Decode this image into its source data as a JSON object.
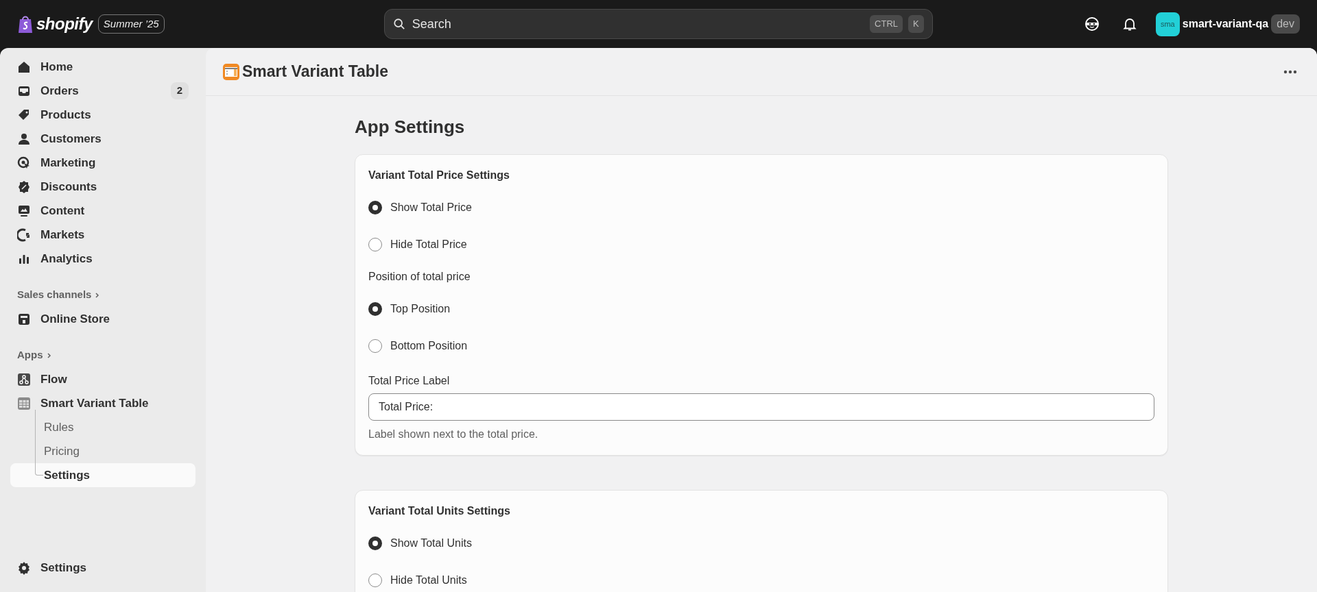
{
  "topbar": {
    "logo_text": "shopify",
    "edition_badge": "Summer ’25",
    "search": {
      "placeholder": "Search",
      "shortcut_keys": [
        "CTRL",
        "K"
      ]
    },
    "store": {
      "avatar_text": "sma",
      "name": "smart-variant-qa",
      "badge": "dev"
    }
  },
  "sidebar": {
    "items": [
      {
        "label": "Home",
        "selected": false
      },
      {
        "label": "Orders",
        "badge": "2",
        "selected": false
      },
      {
        "label": "Products",
        "selected": false
      },
      {
        "label": "Customers",
        "selected": false
      },
      {
        "label": "Marketing",
        "selected": false
      },
      {
        "label": "Discounts",
        "selected": false
      },
      {
        "label": "Content",
        "selected": false
      },
      {
        "label": "Markets",
        "selected": false
      },
      {
        "label": "Analytics",
        "selected": false
      }
    ],
    "sections": [
      {
        "title": "Sales channels",
        "items": [
          {
            "label": "Online Store",
            "selected": false
          }
        ]
      },
      {
        "title": "Apps",
        "items": [
          {
            "label": "Flow",
            "selected": false
          },
          {
            "label": "Smart Variant Table",
            "selected": false,
            "children": [
              {
                "label": "Rules",
                "selected": false
              },
              {
                "label": "Pricing",
                "selected": false
              },
              {
                "label": "Settings",
                "selected": true
              }
            ]
          }
        ]
      }
    ],
    "footer_item": {
      "label": "Settings",
      "selected": false
    }
  },
  "page_header": {
    "title": "Smart Variant Table"
  },
  "content": {
    "title": "App Settings",
    "cards": [
      {
        "title": "Variant Total Price Settings",
        "items": [
          {
            "kind": "radio",
            "label": "Show Total Price",
            "selected": true
          },
          {
            "kind": "radio",
            "label": "Hide Total Price",
            "selected": false
          },
          {
            "kind": "caption",
            "text": "Position of total price"
          },
          {
            "kind": "radio",
            "label": "Top Position",
            "selected": true
          },
          {
            "kind": "radio",
            "label": "Bottom Position",
            "selected": false
          },
          {
            "kind": "text_field",
            "label": "Total Price Label",
            "value": "Total Price:",
            "help": "Label shown next to the total price."
          }
        ]
      },
      {
        "title": "Variant Total Units Settings",
        "items": [
          {
            "kind": "radio",
            "label": "Show Total Units",
            "selected": true
          },
          {
            "kind": "radio",
            "label": "Hide Total Units",
            "selected": false
          }
        ]
      }
    ]
  }
}
